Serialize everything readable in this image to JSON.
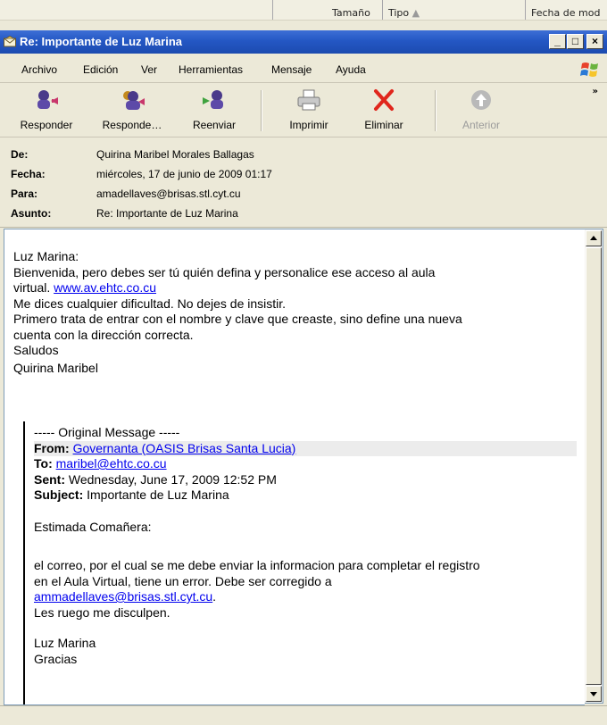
{
  "background_window": {
    "columns": [
      "Tamaño",
      "Tipo",
      "Fecha de mod"
    ]
  },
  "window": {
    "title": "Re: Importante de Luz Marina",
    "controls": {
      "minimize": "_",
      "maximize": "□",
      "close": "×"
    }
  },
  "menu": [
    "Archivo",
    "Edición",
    "Ver",
    "Herramientas",
    "Mensaje",
    "Ayuda"
  ],
  "toolbar": {
    "reply": "Responder",
    "reply_all": "Responde…",
    "forward": "Reenviar",
    "print": "Imprimir",
    "delete": "Eliminar",
    "previous": "Anterior",
    "more": "»"
  },
  "header": {
    "from_label": "De:",
    "from_value": "Quirina Maribel Morales Ballagas",
    "date_label": "Fecha:",
    "date_value": "miércoles, 17 de junio de 2009 01:17",
    "to_label": "Para:",
    "to_value": "amadellaves@brisas.stl.cyt.cu",
    "subject_label": "Asunto:",
    "subject_value": "Re: Importante de Luz Marina"
  },
  "message": {
    "greeting": "Luz Marina:",
    "line1": "Bienvenida, pero debes ser tú quién defina y personalice ese acceso al aula",
    "line2_text": "virtual. ",
    "line2_link": "www.av.ehtc.co.cu",
    "line3": "Me dices cualquier dificultad. No dejes de insistir.",
    "line4": "Primero trata de entrar con el nombre y clave que creaste, sino define una nueva",
    "line5": "cuenta con la dirección correcta.",
    "closing": "Saludos",
    "signature": "Quirina Maribel"
  },
  "quoted": {
    "separator": "----- Original Message -----",
    "from_label": "From:",
    "from_link": "Governanta (OASIS Brisas Santa Lucia)",
    "to_label": "To:",
    "to_link": "maribel@ehtc.co.cu",
    "sent_label": "Sent:",
    "sent_value": "Wednesday, June 17, 2009 12:52 PM",
    "subject_label": "Subject:",
    "subject_value": "Importante de Luz Marina",
    "salutation": "Estimada Comañera:",
    "body1": "el correo, por el cual se me debe enviar la informacion para completar el registro",
    "body2": "en el Aula Virtual, tiene un error. Debe ser corregido a",
    "body3_link": "ammadellaves@brisas.stl.cyt.cu",
    "body3_tail": ".",
    "body4": "Les ruego me disculpen.",
    "sign1": "Luz Marina",
    "sign2": "Gracias"
  }
}
